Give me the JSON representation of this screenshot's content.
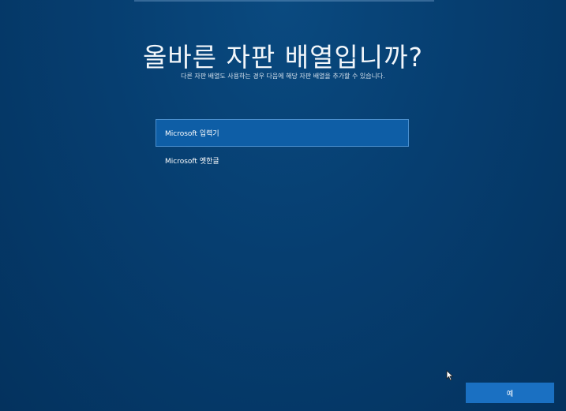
{
  "page": {
    "title": "올바른 자판 배열입니까?",
    "subtitle": "다른 자판 배열도 사용하는 경우 다음에 해당 자판 배열을 추가할 수 있습니다."
  },
  "layouts": [
    {
      "label": "Microsoft 입력기",
      "selected": true
    },
    {
      "label": "Microsoft 옛한글",
      "selected": false
    }
  ],
  "footer": {
    "yes_label": "예"
  },
  "colors": {
    "background": "#063e70",
    "selected_item": "#0e5ea6",
    "button": "#1a70c2"
  }
}
